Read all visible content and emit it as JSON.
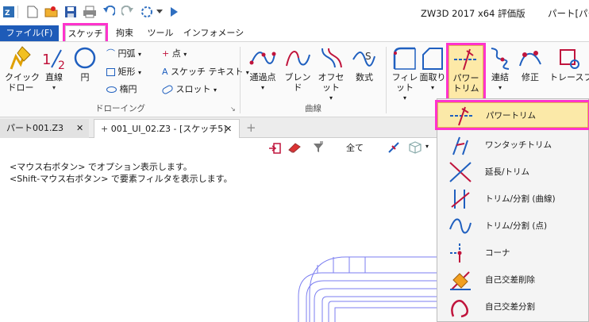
{
  "titlebar": {
    "app_title": "ZW3D 2017  x64 評価版",
    "doc_title": "パート[パート"
  },
  "tabs": [
    "ファイル(F)",
    "スケッチ",
    "拘束",
    "ツール",
    "インフォメーション"
  ],
  "ribbon": {
    "quick_draw": "クイック\nドロー",
    "line": "直線",
    "circle": "円",
    "small": {
      "arc": "円弧",
      "point": "点",
      "rect": "矩形",
      "sketch_text": "スケッチ テキスト",
      "ellipse": "楕円",
      "slot": "スロット"
    },
    "drawing_group": "ドローイング",
    "via_point": "通過点",
    "blend": "ブレンド",
    "offset": "オフセット",
    "formula": "数式",
    "curve_group": "曲線",
    "fillet": "フィレット",
    "chamfer": "面取り",
    "power_trim": "パワー\nトリム",
    "connect": "連結",
    "modify": "修正",
    "trace_profile": "トレースプロフ"
  },
  "doc_tabs": [
    {
      "label": "パート001.Z3"
    },
    {
      "label": "001_UI_02.Z3 - [スケッチ5]"
    }
  ],
  "canvas": {
    "hint1": "<マウス右ボタン> でオプション表示します。",
    "hint2": "<Shift-マウス右ボタン> で要素フィルタを表示します。",
    "filter_all": "全て"
  },
  "dropdown_items": [
    "パワートリム",
    "ワンタッチトリム",
    "延長/トリム",
    "トリム/分割 (曲線)",
    "トリム/分割 (点)",
    "コーナ",
    "自己交差削除",
    "自己交差分割"
  ],
  "colors": {
    "file_tab_bg": "#1e5bb8",
    "highlight": "#ff33cc",
    "selected_bg": "#fbe9a8",
    "icon_red": "#c0143c",
    "icon_blue": "#1f5fbf"
  }
}
